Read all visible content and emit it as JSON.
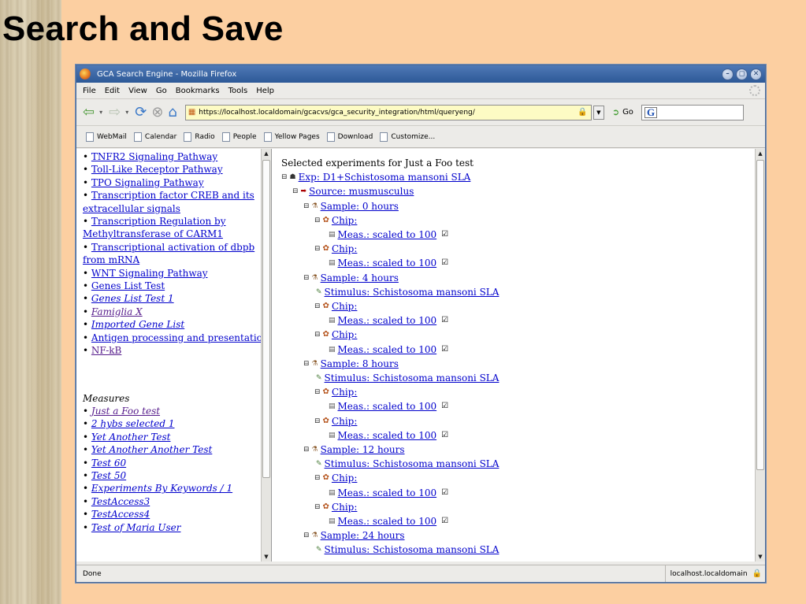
{
  "slide": {
    "title": "Search and Save"
  },
  "window": {
    "title": "GCA Search Engine - Mozilla Firefox"
  },
  "menu": [
    "File",
    "Edit",
    "View",
    "Go",
    "Bookmarks",
    "Tools",
    "Help"
  ],
  "address": {
    "url": "https://localhost.localdomain/gcacvs/gca_security_integration/html/queryeng/",
    "go_label": "Go"
  },
  "bookmarks": [
    "WebMail",
    "Calendar",
    "Radio",
    "People",
    "Yellow Pages",
    "Download",
    "Customize..."
  ],
  "left": {
    "pathways": [
      "TNFR2 Signaling Pathway",
      "Toll-Like Receptor Pathway",
      "TPO Signaling Pathway",
      "Transcription factor CREB and its extracellular signals",
      "Transcription Regulation by Methyltransferase of CARM1",
      "Transcriptional activation of dbpb from mRNA",
      "WNT Signaling Pathway",
      "Genes List Test",
      "Genes List Test 1",
      "Famiglia X",
      "Imported Gene List",
      "Antigen processing and presentation",
      "NF-kB"
    ],
    "measures_heading": "Measures",
    "measures": [
      "Just a Foo test",
      "2 hybs selected 1",
      "Yet Another Test",
      "Yet Another Another Test",
      "Test 60",
      "Test 50",
      "Experiments By Keywords / 1",
      "TestAccess3",
      "TestAccess4",
      "Test of Maria User"
    ]
  },
  "right": {
    "heading": "Selected experiments for Just a Foo test",
    "exp": "Exp: D1+Schistosoma mansoni SLA",
    "source": "Source: musmusculus",
    "chip": "Chip:",
    "meas": "Meas.: scaled to 100",
    "stimulus": "Stimulus: Schistosoma mansoni SLA",
    "samples": [
      "Sample: 0 hours",
      "Sample: 4 hours",
      "Sample: 8 hours",
      "Sample: 12 hours",
      "Sample: 24 hours"
    ]
  },
  "status": {
    "left": "Done",
    "host": "localhost.localdomain"
  }
}
